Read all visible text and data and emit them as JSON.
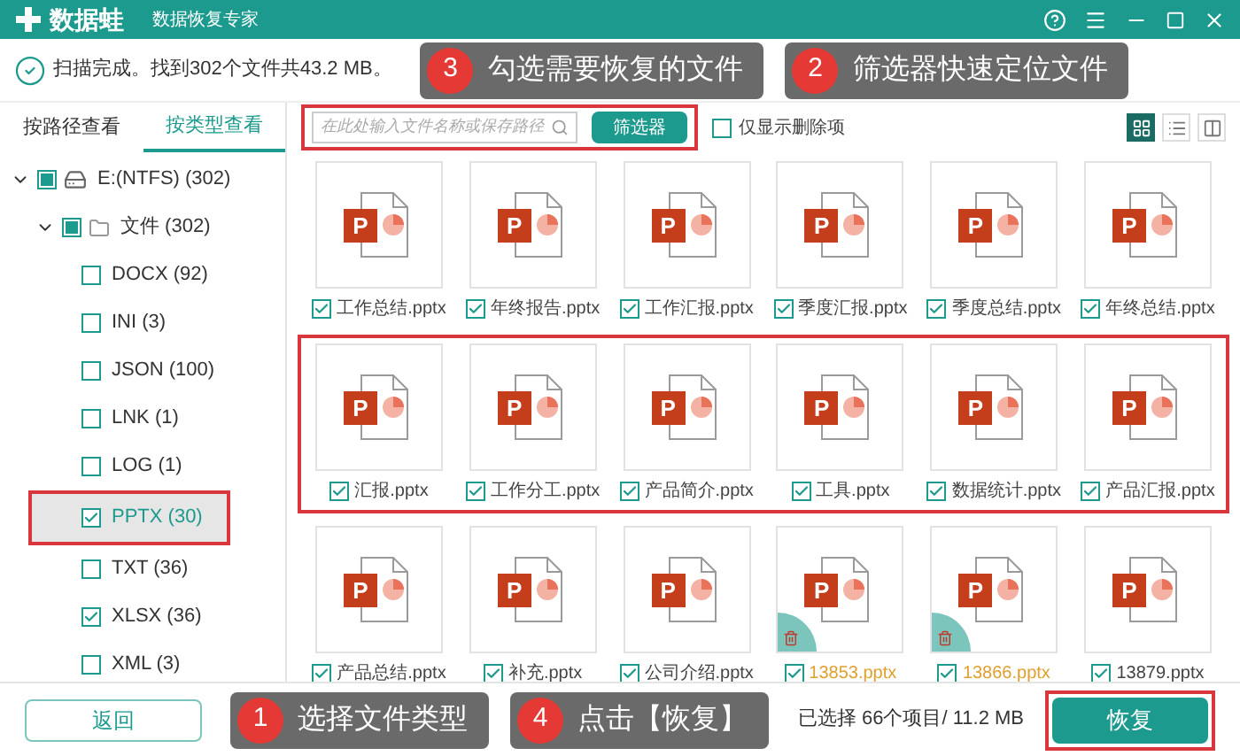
{
  "window": {
    "logo_text": "数据蛙",
    "subtitle": "数据恢复专家"
  },
  "status": {
    "message": "扫描完成。找到302个文件共43.2 MB。"
  },
  "tabs": [
    {
      "label": "按路径查看",
      "selected": false
    },
    {
      "label": "按类型查看",
      "selected": true
    }
  ],
  "tree": [
    {
      "label": "E:(NTFS) (302)",
      "kind": "drive",
      "partial": true,
      "expanded": true,
      "children": [
        {
          "label": "文件 (302)",
          "kind": "folder",
          "partial": true,
          "expanded": true,
          "children": [
            {
              "label": "DOCX (92)",
              "kind": "type",
              "checked": false,
              "selected": false,
              "highlighted": false
            },
            {
              "label": "INI (3)",
              "kind": "type",
              "checked": false,
              "selected": false,
              "highlighted": false
            },
            {
              "label": "JSON (100)",
              "kind": "type",
              "checked": false,
              "selected": false,
              "highlighted": false
            },
            {
              "label": "LNK (1)",
              "kind": "type",
              "checked": false,
              "selected": false,
              "highlighted": false
            },
            {
              "label": "LOG (1)",
              "kind": "type",
              "checked": false,
              "selected": false,
              "highlighted": false
            },
            {
              "label": "PPTX (30)",
              "kind": "type",
              "checked": true,
              "selected": true,
              "highlighted": true
            },
            {
              "label": "TXT (36)",
              "kind": "type",
              "checked": false,
              "selected": false,
              "highlighted": false
            },
            {
              "label": "XLSX (36)",
              "kind": "type",
              "checked": true,
              "selected": false,
              "highlighted": false
            },
            {
              "label": "XML (3)",
              "kind": "type",
              "checked": false,
              "selected": false,
              "highlighted": false
            }
          ]
        }
      ]
    }
  ],
  "search": {
    "placeholder": "在此处输入文件名称或保存路径",
    "highlighted": true
  },
  "filter_button": "筛选器",
  "deleted_only": {
    "label": "仅显示删除项",
    "checked": false
  },
  "views": [
    {
      "kind": "grid",
      "selected": true
    },
    {
      "kind": "list",
      "selected": false
    },
    {
      "kind": "columns",
      "selected": false
    }
  ],
  "file_rows": [
    {
      "highlighted": false,
      "files": [
        {
          "name": "工作总结.pptx",
          "icon_letter": "P",
          "checked": true,
          "deleted": false
        },
        {
          "name": "年终报告.pptx",
          "icon_letter": "P",
          "checked": true,
          "deleted": false
        },
        {
          "name": "工作汇报.pptx",
          "icon_letter": "P",
          "checked": true,
          "deleted": false
        },
        {
          "name": "季度汇报.pptx",
          "icon_letter": "P",
          "checked": true,
          "deleted": false
        },
        {
          "name": "季度总结.pptx",
          "icon_letter": "P",
          "checked": true,
          "deleted": false
        },
        {
          "name": "年终总结.pptx",
          "icon_letter": "P",
          "checked": true,
          "deleted": false
        }
      ]
    },
    {
      "highlighted": true,
      "files": [
        {
          "name": "汇报.pptx",
          "icon_letter": "P",
          "checked": true,
          "deleted": false
        },
        {
          "name": "工作分工.pptx",
          "icon_letter": "P",
          "checked": true,
          "deleted": false
        },
        {
          "name": "产品简介.pptx",
          "icon_letter": "P",
          "checked": true,
          "deleted": false
        },
        {
          "name": "工具.pptx",
          "icon_letter": "P",
          "checked": true,
          "deleted": false
        },
        {
          "name": "数据统计.pptx",
          "icon_letter": "P",
          "checked": true,
          "deleted": false
        },
        {
          "name": "产品汇报.pptx",
          "icon_letter": "P",
          "checked": true,
          "deleted": false
        }
      ]
    },
    {
      "highlighted": false,
      "files": [
        {
          "name": "产品总结.pptx",
          "icon_letter": "P",
          "checked": true,
          "deleted": false
        },
        {
          "name": "补充.pptx",
          "icon_letter": "P",
          "checked": true,
          "deleted": false
        },
        {
          "name": "公司介绍.pptx",
          "icon_letter": "P",
          "checked": true,
          "deleted": false
        },
        {
          "name": "13853.pptx",
          "icon_letter": "P",
          "checked": true,
          "deleted": true
        },
        {
          "name": "13866.pptx",
          "icon_letter": "P",
          "checked": true,
          "deleted": true
        },
        {
          "name": "13879.pptx",
          "icon_letter": "P",
          "checked": true,
          "deleted": false
        }
      ]
    }
  ],
  "footer": {
    "back_button": "返回",
    "summary": "已选择 66个项目/ 11.2 MB",
    "recover_button": "恢复",
    "recover_highlighted": true
  },
  "callouts_top": [
    {
      "number": "3",
      "text": "勾选需要恢复的文件"
    },
    {
      "number": "2",
      "text": "筛选器快速定位文件"
    }
  ],
  "callouts_bottom": [
    {
      "number": "1",
      "text": "选择文件类型"
    },
    {
      "number": "4",
      "text": "点击【恢复】"
    }
  ]
}
